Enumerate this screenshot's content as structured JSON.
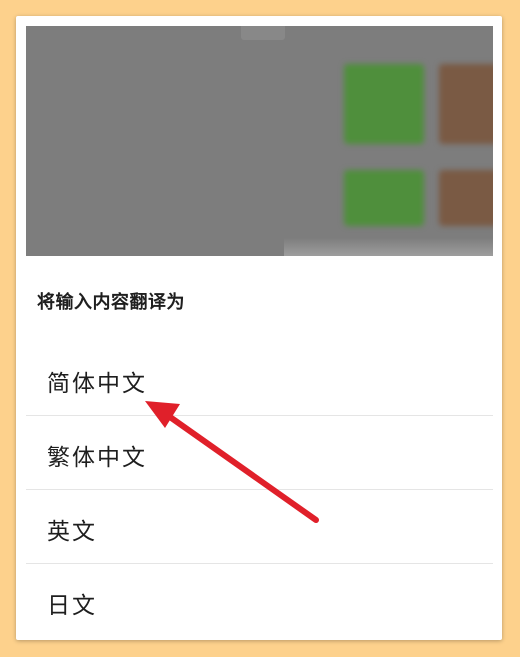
{
  "sheet": {
    "title": "将输入内容翻译为",
    "options": [
      {
        "label": "简体中文"
      },
      {
        "label": "繁体中文"
      },
      {
        "label": "英文"
      },
      {
        "label": "日文"
      }
    ]
  },
  "colors": {
    "page_background": "#fdd18c",
    "arrow": "#e0202a",
    "backdrop": "#7d7d7d",
    "blurred_green": "#4f8f3c"
  }
}
